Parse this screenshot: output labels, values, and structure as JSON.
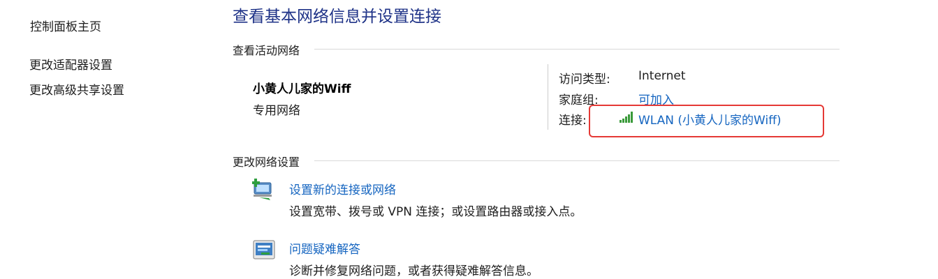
{
  "sidebar": {
    "home": "控制面板主页",
    "items": [
      {
        "label": "更改适配器设置"
      },
      {
        "label": "更改高级共享设置"
      }
    ]
  },
  "main": {
    "title": "查看基本网络信息并设置连接",
    "active_networks": {
      "header": "查看活动网络",
      "network_name": "小黄人儿家的Wiff",
      "network_type": "专用网络",
      "properties": {
        "access_type_label": "访问类型:",
        "access_type_value": "Internet",
        "homegroup_label": "家庭组:",
        "homegroup_value": "可加入",
        "connections_label": "连接:",
        "connections_value": "WLAN (小黄人儿家的Wiff)",
        "connection_icon": "wifi-signal-icon"
      }
    },
    "change_settings": {
      "header": "更改网络设置",
      "tasks": [
        {
          "icon": "new-connection-icon",
          "title": "设置新的连接或网络",
          "desc": "设置宽带、拨号或 VPN 连接；或设置路由器或接入点。"
        },
        {
          "icon": "troubleshoot-icon",
          "title": "问题疑难解答",
          "desc": "诊断并修复网络问题，或者获得疑难解答信息。"
        }
      ]
    },
    "colors": {
      "title": "#1e3287",
      "link": "#1565c0",
      "highlight": "#e53935"
    }
  }
}
